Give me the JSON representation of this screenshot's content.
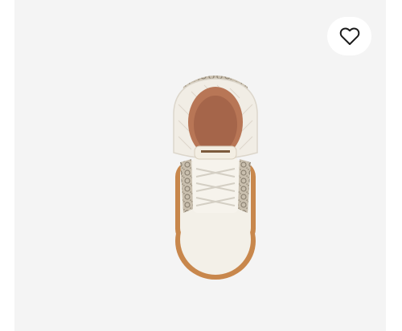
{
  "product": {
    "image_icon": "boot-top-view-image",
    "background_color": "#f4f4f4"
  },
  "wishlist": {
    "icon": "heart-outline-icon"
  }
}
